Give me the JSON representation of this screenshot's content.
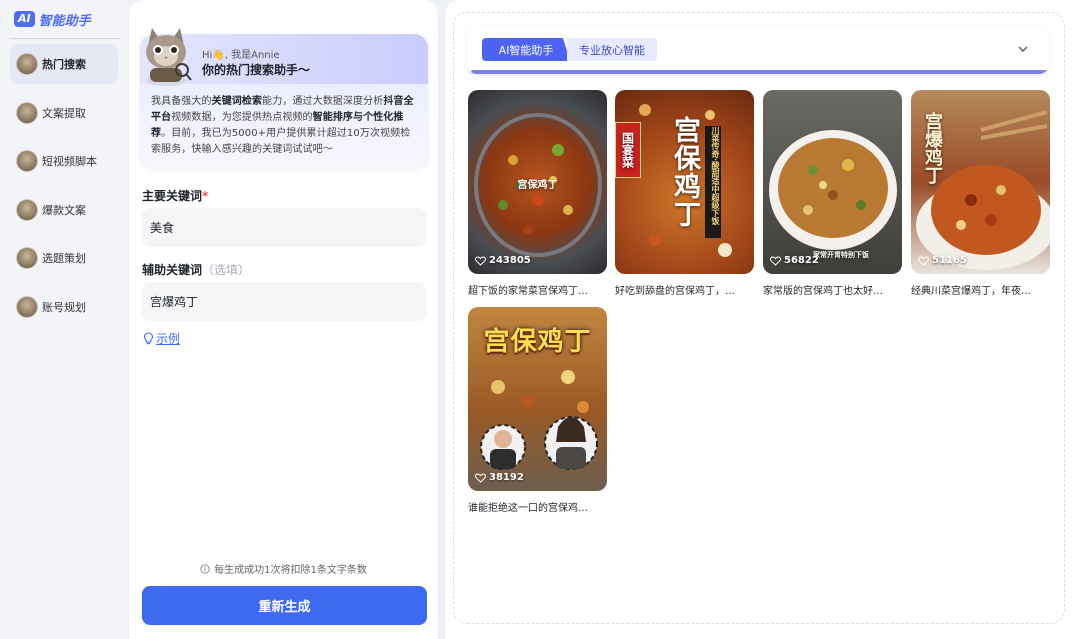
{
  "brand": {
    "badge": "AI",
    "name": "智能助手",
    "accent": "#4f6cf7"
  },
  "sidebar": {
    "items": [
      {
        "label": "热门搜索",
        "active": true
      },
      {
        "label": "文案提取",
        "active": false
      },
      {
        "label": "短视频脚本",
        "active": false
      },
      {
        "label": "爆款文案",
        "active": false
      },
      {
        "label": "选题策划",
        "active": false
      },
      {
        "label": "账号规划",
        "active": false
      }
    ]
  },
  "intro": {
    "greeting": "Hi👋, 我是Annie",
    "title": "你的热门搜索助手～",
    "text_parts": [
      "我具备强大的",
      "关键词检索",
      "能力，通过大数据深度分析",
      "抖音全平台",
      "视频数据，为您提供热点视频的",
      "智能排序与个性化推荐",
      "。目前，我已为5000+用户提供累计超过10万次视频检索服务，快输入感兴趣的关键词试试吧～"
    ]
  },
  "form": {
    "main_keyword_label": "主要关键词",
    "required_mark": "*",
    "main_keyword_value": "美食",
    "aux_keyword_label": "辅助关键词",
    "aux_optional": "（选填）",
    "aux_keyword_value": "宫爆鸡丁",
    "example_link": "示例",
    "notice": "每生成成功1次将扣除1条文字条数",
    "regenerate_label": "重新生成"
  },
  "results": {
    "tabs": [
      {
        "label": "AI智能助手",
        "active": true
      },
      {
        "label": "专业放心智能",
        "active": false
      }
    ],
    "cards": [
      {
        "title": "超下饭的家常菜宫保鸡丁…",
        "likes": "243805",
        "overlay": "宫保鸡丁"
      },
      {
        "title": "好吃到舔盘的宫保鸡丁，…",
        "likes": "",
        "overlay": "宫保鸡丁",
        "tag": "国宴菜",
        "side": "川菜传奇·酸甜适中超级下饭"
      },
      {
        "title": "家常版的宫保鸡丁也太好…",
        "likes": "56822",
        "overlay": "家常开胃特别下饭"
      },
      {
        "title": "经典川菜宫爆鸡丁，年夜…",
        "likes": "51165",
        "overlay": "宫爆鸡丁"
      },
      {
        "title": "谁能拒绝这一口的宫保鸡…",
        "likes": "38192",
        "overlay": "宫保鸡丁"
      }
    ]
  }
}
